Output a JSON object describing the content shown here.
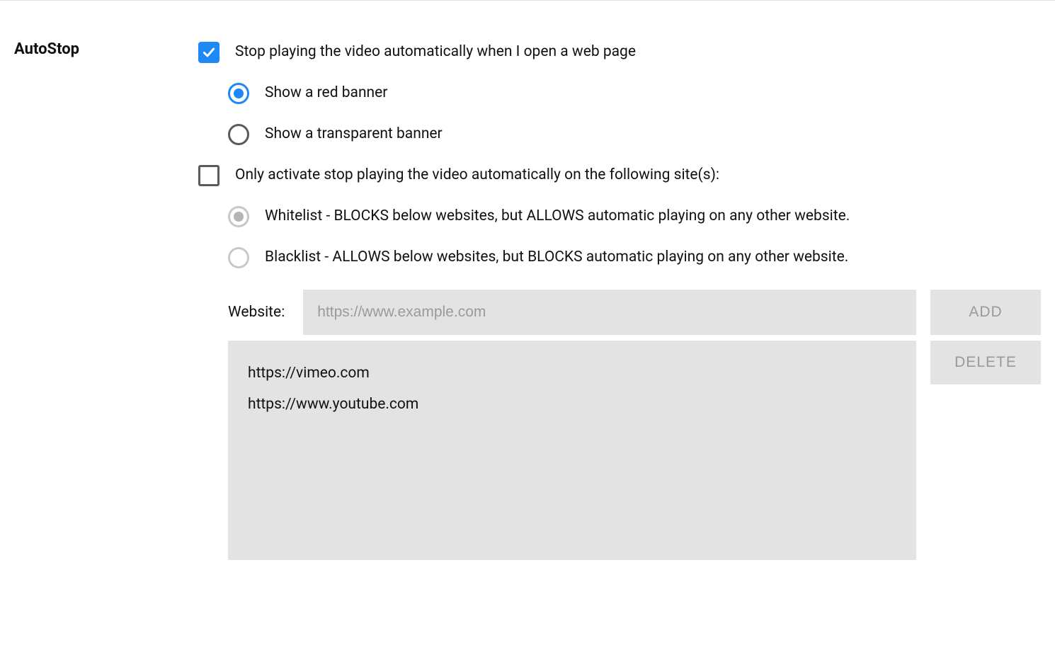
{
  "section": {
    "title": "AutoStop"
  },
  "checkbox_main": {
    "label": "Stop playing the video automatically when I open a web page",
    "checked": true
  },
  "banner": {
    "red": {
      "label": "Show a red banner",
      "selected": true
    },
    "transparent": {
      "label": "Show a transparent banner",
      "selected": false
    }
  },
  "checkbox_sites": {
    "label": "Only activate stop playing the video automatically on the following site(s):",
    "checked": false
  },
  "list_mode": {
    "whitelist": {
      "label": "Whitelist - BLOCKS below websites, but ALLOWS automatic playing on any other website.",
      "selected": true
    },
    "blacklist": {
      "label": "Blacklist - ALLOWS below websites, but BLOCKS automatic playing on any other website.",
      "selected": false
    }
  },
  "website": {
    "field_label": "Website:",
    "placeholder": "https://www.example.com",
    "value": "",
    "add_label": "ADD",
    "delete_label": "DELETE",
    "items": [
      "https://vimeo.com",
      "https://www.youtube.com"
    ]
  }
}
